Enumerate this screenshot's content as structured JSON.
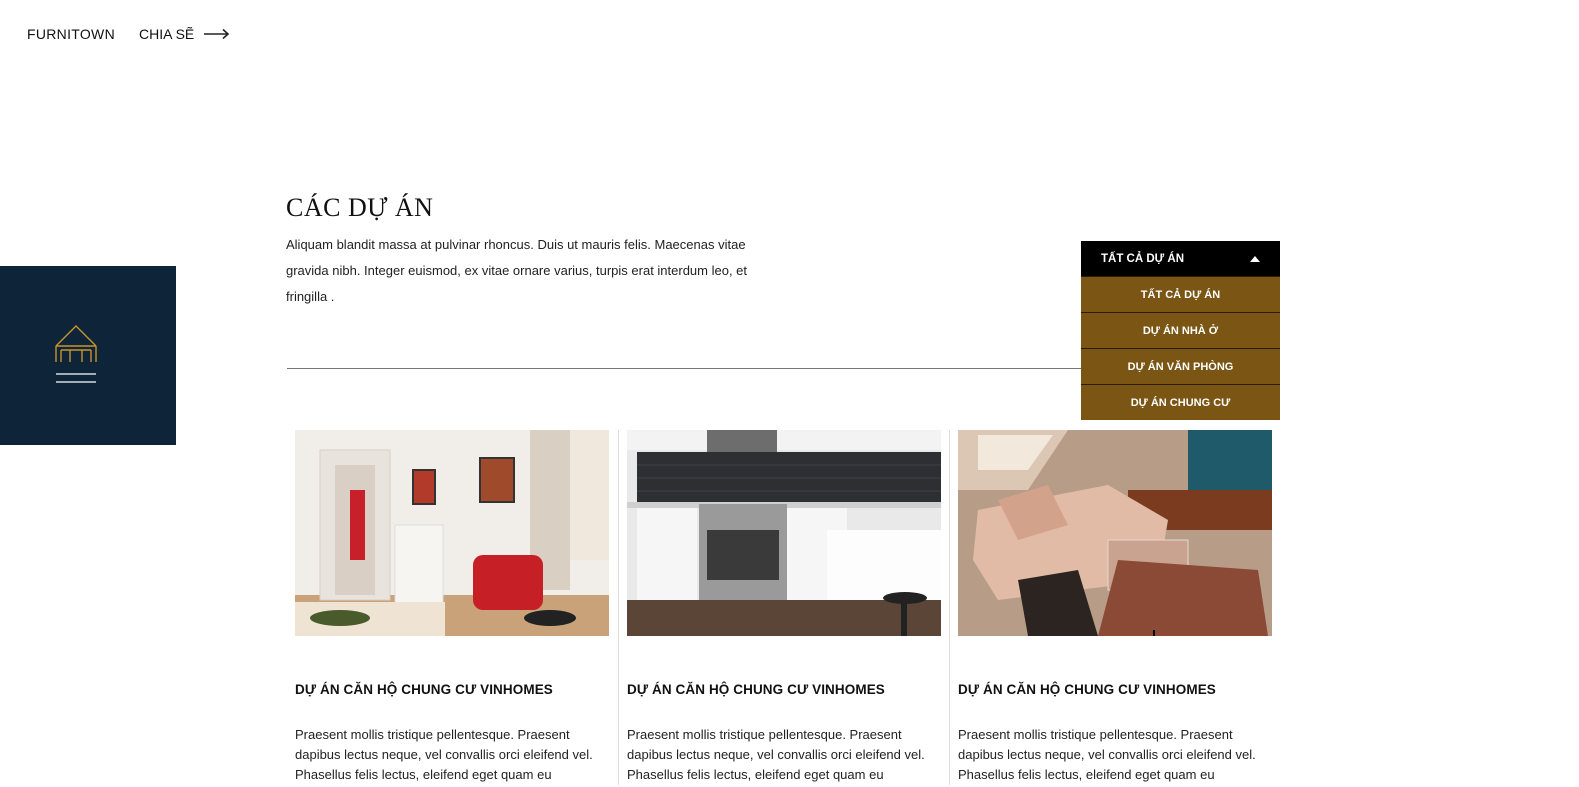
{
  "header": {
    "brand": "FURNITOWN",
    "share_label": "CHIA SẼ"
  },
  "page": {
    "title": "CÁC DỰ ÁN",
    "intro": "Aliquam blandit massa at pulvinar rhoncus. Duis ut mauris felis. Maecenas vitae gravida nibh. Integer euismod, ex vitae ornare varius, turpis erat interdum leo, et fringilla ."
  },
  "filter": {
    "selected": "TẤT CẢ DỰ ÁN",
    "options": [
      "TẤT CẢ DỰ ÁN",
      "DỰ ÁN NHÀ Ở",
      "DỰ ÁN VĂN PHÒNG",
      "DỰ ÁN CHUNG CƯ"
    ]
  },
  "projects": [
    {
      "title": "DỰ ÁN CĂN HỘ CHUNG CƯ VINHOMES",
      "description": "Praesent mollis tristique pellentesque. Praesent dapibus lectus neque, vel convallis orci eleifend vel. Phasellus felis lectus, eleifend eget quam eu"
    },
    {
      "title": "DỰ ÁN CĂN HỘ CHUNG CƯ VINHOMES",
      "description": "Praesent mollis tristique pellentesque. Praesent dapibus lectus neque, vel convallis orci eleifend vel. Phasellus felis lectus, eleifend eget quam eu"
    },
    {
      "title": "DỰ ÁN CĂN HỘ CHUNG CƯ VINHOMES",
      "description": "Praesent mollis tristique pellentesque. Praesent dapibus lectus neque, vel convallis orci eleifend vel. Phasellus felis lectus, eleifend eget quam eu"
    }
  ],
  "colors": {
    "logo_panel": "#0e2438",
    "logo_gold": "#c8932e",
    "filter_head": "#000000",
    "filter_item": "#7a5514"
  }
}
